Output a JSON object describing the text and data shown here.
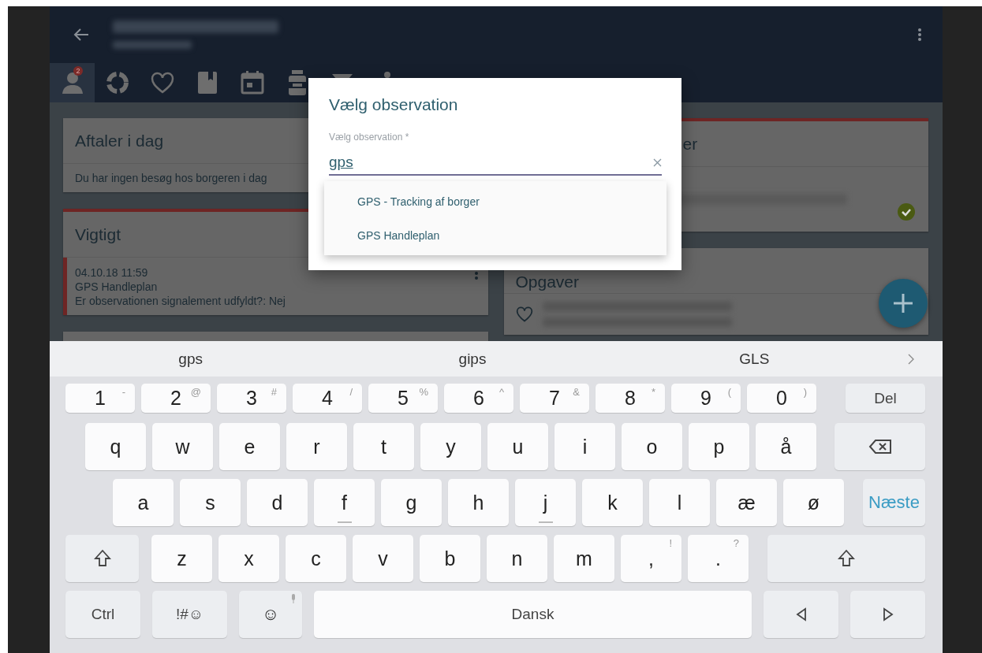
{
  "tabs": [
    {
      "kind": "person",
      "selected": true,
      "badge": "2"
    },
    {
      "kind": "ring",
      "selected": false
    },
    {
      "kind": "heart",
      "selected": false
    },
    {
      "kind": "book",
      "selected": false
    },
    {
      "kind": "calendar",
      "selected": false
    },
    {
      "kind": "jar",
      "selected": false
    },
    {
      "kind": "funnel",
      "selected": false
    },
    {
      "kind": "figure",
      "selected": false
    }
  ],
  "left_cards": [
    {
      "title": "Aftaler i dag",
      "accent": false,
      "entries": [
        {
          "kind": "text",
          "text": "Du har ingen besøg hos borgeren i dag"
        }
      ]
    },
    {
      "title": "Vigtigt",
      "accent": true,
      "entries": [
        {
          "kind": "note",
          "lines": [
            "04.10.18 11:59",
            "GPS Handleplan",
            "Er observationen signalement udfyldt?: Nej"
          ]
        }
      ]
    },
    {
      "accent": false
    }
  ],
  "right_cards": [
    {
      "title": "er",
      "accent": true,
      "done": true,
      "entries": [
        {
          "kind": "blurred"
        }
      ]
    },
    {
      "title": "Opgaver",
      "accent": false,
      "entries": [
        {
          "kind": "task"
        }
      ]
    }
  ],
  "dialog": {
    "title": "Vælg observation",
    "label": "Vælg observation *",
    "value": "gps",
    "options": [
      "GPS - Tracking af borger",
      "GPS Handleplan"
    ]
  },
  "keyboard": {
    "suggestions": [
      "gps",
      "gips",
      "GLS"
    ],
    "number_row": [
      {
        "kind": "char",
        "main": "1",
        "alt": "-"
      },
      {
        "kind": "char",
        "main": "2",
        "alt": "@"
      },
      {
        "kind": "char",
        "main": "3",
        "alt": "#"
      },
      {
        "kind": "char",
        "main": "4",
        "alt": "/"
      },
      {
        "kind": "char",
        "main": "5",
        "alt": "%"
      },
      {
        "kind": "char",
        "main": "6",
        "alt": "^"
      },
      {
        "kind": "char",
        "main": "7",
        "alt": "&"
      },
      {
        "kind": "char",
        "main": "8",
        "alt": "*"
      },
      {
        "kind": "char",
        "main": "9",
        "alt": "("
      },
      {
        "kind": "char",
        "main": "0",
        "alt": ")"
      },
      {
        "kind": "label",
        "main": "Del"
      }
    ],
    "top_row": [
      {
        "kind": "char",
        "main": "q"
      },
      {
        "kind": "char",
        "main": "w"
      },
      {
        "kind": "char",
        "main": "e"
      },
      {
        "kind": "char",
        "main": "r"
      },
      {
        "kind": "char",
        "main": "t"
      },
      {
        "kind": "char",
        "main": "y"
      },
      {
        "kind": "char",
        "main": "u"
      },
      {
        "kind": "char",
        "main": "i"
      },
      {
        "kind": "char",
        "main": "o"
      },
      {
        "kind": "char",
        "main": "p"
      },
      {
        "kind": "char",
        "main": "å"
      },
      {
        "kind": "backspace"
      }
    ],
    "home_row": [
      {
        "kind": "char",
        "main": "a"
      },
      {
        "kind": "char",
        "main": "s"
      },
      {
        "kind": "char",
        "main": "d"
      },
      {
        "kind": "char",
        "main": "f",
        "home": true
      },
      {
        "kind": "char",
        "main": "g"
      },
      {
        "kind": "char",
        "main": "h"
      },
      {
        "kind": "char",
        "main": "j",
        "home": true
      },
      {
        "kind": "char",
        "main": "k"
      },
      {
        "kind": "char",
        "main": "l"
      },
      {
        "kind": "char",
        "main": "æ"
      },
      {
        "kind": "char",
        "main": "ø"
      },
      {
        "kind": "action",
        "main": "Næste"
      }
    ],
    "bottom_row": [
      {
        "kind": "shift"
      },
      {
        "kind": "char",
        "main": "z"
      },
      {
        "kind": "char",
        "main": "x"
      },
      {
        "kind": "char",
        "main": "c"
      },
      {
        "kind": "char",
        "main": "v"
      },
      {
        "kind": "char",
        "main": "b"
      },
      {
        "kind": "char",
        "main": "n"
      },
      {
        "kind": "char",
        "main": "m"
      },
      {
        "kind": "char",
        "main": ",",
        "alt": "!"
      },
      {
        "kind": "char",
        "main": ".",
        "alt": "?"
      },
      {
        "kind": "shift"
      }
    ],
    "space_row": [
      {
        "kind": "label",
        "main": "Ctrl"
      },
      {
        "kind": "label",
        "main": "!#☺"
      },
      {
        "kind": "emoji",
        "main": "☺"
      },
      {
        "kind": "space",
        "main": "Dansk"
      },
      {
        "kind": "left"
      },
      {
        "kind": "right"
      }
    ]
  }
}
